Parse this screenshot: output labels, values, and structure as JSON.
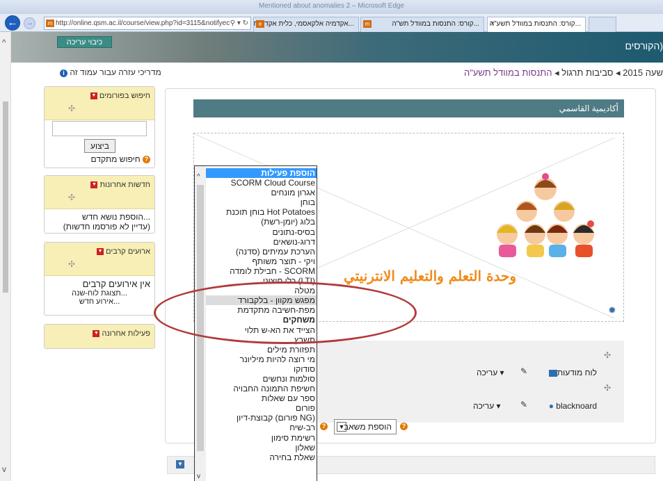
{
  "browser": {
    "title": "Mentioned about anomalies 2 – Microsoft Edge",
    "address": "http://online.qsm.ac.il/course/view.php?id=3115&notifyec",
    "tabs": [
      {
        "label": "...אקדמיה אלקאסמי, כלית אקדמית לחינוך",
        "active": false
      },
      {
        "label": "...קורס: התנסות במוודל תש\"ה",
        "active": false
      },
      {
        "label": "...קורס: התנסות במוודל תשע\"ה",
        "active": true
      }
    ]
  },
  "header": {
    "edit_button": "כיבוי עריכה",
    "site_name": "הקורסים)",
    "help_link": "מדריכי עזרה עבור עמוד זה",
    "breadcrumb_prefix": "שעה 2015",
    "breadcrumb_mid": "סביבות תרגול",
    "breadcrumb_current": "התנסות במוודל תשע\"ה"
  },
  "sidebar": {
    "forum_search": {
      "title": "חיפוש בפורומים",
      "button": "ביצוע",
      "advanced": "חיפוש מתקדם"
    },
    "news": {
      "title": "חדשות אחרונות",
      "add": "הוספת נושא חדש...",
      "empty": "(עדיין לא פורסמו חדשות)"
    },
    "events": {
      "title": "ארועים קרבים",
      "empty": "אין אירועים קרבים",
      "calendar": "תצוגת לוח-שנה...",
      "new_event": "אירוע חדש..."
    },
    "recent": {
      "title": "פעילות אחרונה"
    }
  },
  "section": {
    "title": "أكاديمية القاسمي",
    "image_text": "وحدة التعلم والتعليم الانترنيتي"
  },
  "activities": [
    {
      "name": "לוח מודעות",
      "edit": "עריכה"
    },
    {
      "name": "blacknoard",
      "edit": "עריכה"
    }
  ],
  "add_resource": "הוספת משאב",
  "activity_dropdown": {
    "options": [
      "הוספת פעילות",
      "SCORM Cloud Course",
      "אגרון מונחים",
      "בוחן",
      "בוחן תוכנת Hot Potatoes",
      "בלוג (יומן-רשת)",
      "בסיס-נתונים",
      "דרוג-נושאים",
      "הערכת עמיתים (סדנה)",
      "ויקי - תוצר משותף",
      "חבילת לומדה - SCORM",
      "כלי חיצוני (LTI)",
      "מטלה",
      "מפגש מקוון - בלקבורד",
      "מפת-חשיבה מתקדמת",
      "משחקים",
      "הצייד את הא-ש תלוי",
      "תשבץ",
      "תפזורת מילים",
      "מי רוצה להיות מיליונר",
      "סודוקו",
      "סולמות ונחשים",
      "חשיפת התמונה החבויה",
      "ספר עם שאלות",
      "פורום",
      "קבוצת-דיון (פורום NG)",
      "רב-שיח",
      "רשימת סימון",
      "שאלון",
      "שאלת בחירה"
    ]
  }
}
